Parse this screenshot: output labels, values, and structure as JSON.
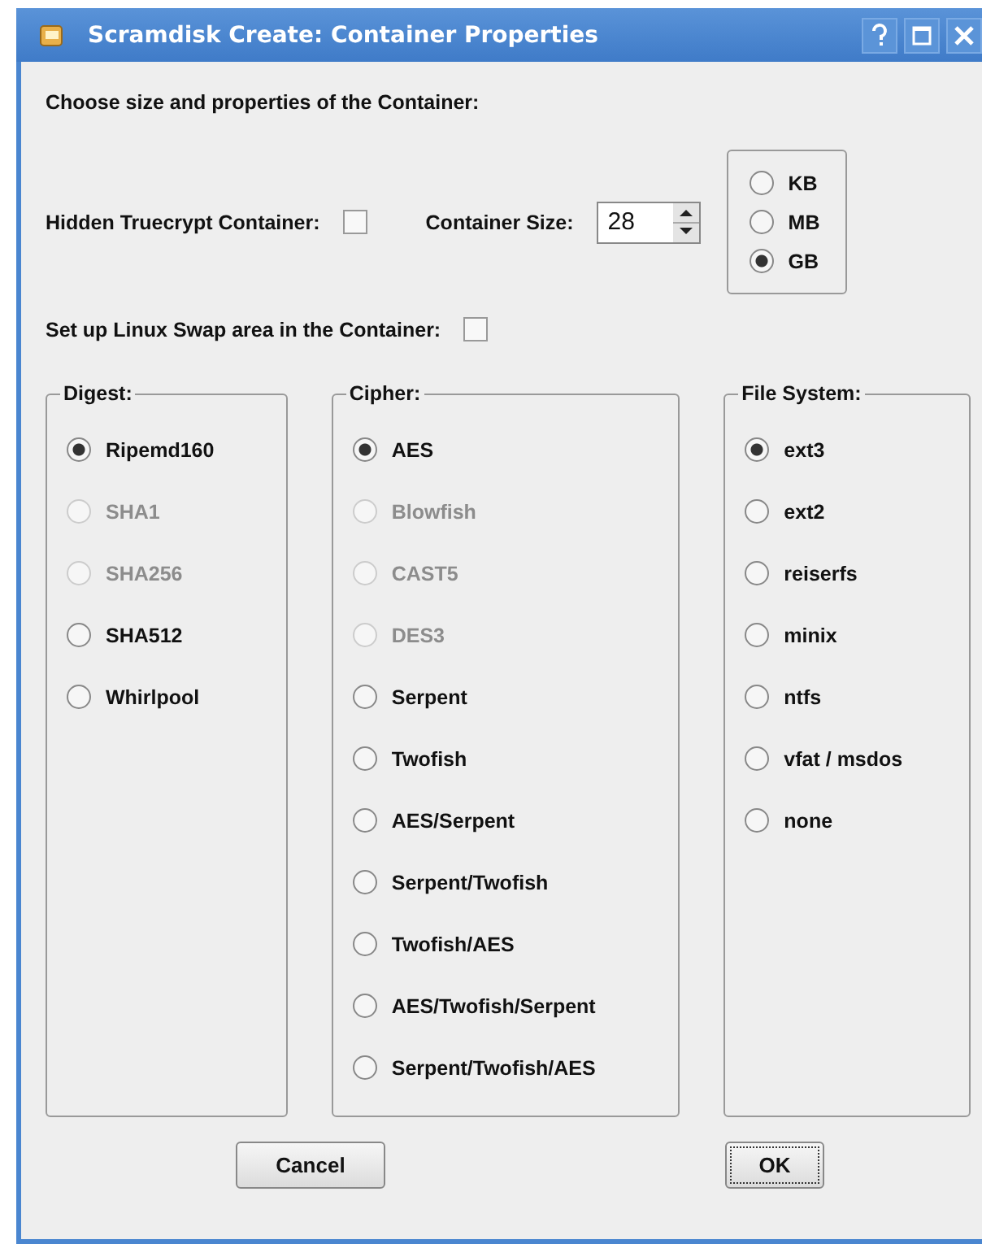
{
  "window": {
    "title": "Scramdisk Create: Container Properties"
  },
  "heading": "Choose size and properties of the Container:",
  "hidden_container": {
    "label": "Hidden Truecrypt Container:",
    "checked": false
  },
  "container_size": {
    "label": "Container Size:",
    "value": "28"
  },
  "units": [
    {
      "label": "KB",
      "selected": false
    },
    {
      "label": "MB",
      "selected": false
    },
    {
      "label": "GB",
      "selected": true
    }
  ],
  "swap": {
    "label": "Set up Linux Swap area in the Container:",
    "checked": false
  },
  "groups": [
    {
      "title": "Digest:",
      "options": [
        {
          "label": "Ripemd160",
          "selected": true,
          "disabled": false
        },
        {
          "label": "SHA1",
          "selected": false,
          "disabled": true
        },
        {
          "label": "SHA256",
          "selected": false,
          "disabled": true
        },
        {
          "label": "SHA512",
          "selected": false,
          "disabled": false
        },
        {
          "label": "Whirlpool",
          "selected": false,
          "disabled": false
        }
      ]
    },
    {
      "title": "Cipher:",
      "options": [
        {
          "label": "AES",
          "selected": true,
          "disabled": false
        },
        {
          "label": "Blowfish",
          "selected": false,
          "disabled": true
        },
        {
          "label": "CAST5",
          "selected": false,
          "disabled": true
        },
        {
          "label": "DES3",
          "selected": false,
          "disabled": true
        },
        {
          "label": "Serpent",
          "selected": false,
          "disabled": false
        },
        {
          "label": "Twofish",
          "selected": false,
          "disabled": false
        },
        {
          "label": "AES/Serpent",
          "selected": false,
          "disabled": false
        },
        {
          "label": "Serpent/Twofish",
          "selected": false,
          "disabled": false
        },
        {
          "label": "Twofish/AES",
          "selected": false,
          "disabled": false
        },
        {
          "label": "AES/Twofish/Serpent",
          "selected": false,
          "disabled": false
        },
        {
          "label": "Serpent/Twofish/AES",
          "selected": false,
          "disabled": false
        }
      ]
    },
    {
      "title": "File System:",
      "options": [
        {
          "label": "ext3",
          "selected": true,
          "disabled": false
        },
        {
          "label": "ext2",
          "selected": false,
          "disabled": false
        },
        {
          "label": "reiserfs",
          "selected": false,
          "disabled": false
        },
        {
          "label": "minix",
          "selected": false,
          "disabled": false
        },
        {
          "label": "ntfs",
          "selected": false,
          "disabled": false
        },
        {
          "label": "vfat / msdos",
          "selected": false,
          "disabled": false
        },
        {
          "label": "none",
          "selected": false,
          "disabled": false
        }
      ]
    }
  ],
  "buttons": [
    {
      "label": "Cancel",
      "focused": false
    },
    {
      "label": "OK",
      "focused": true
    }
  ]
}
